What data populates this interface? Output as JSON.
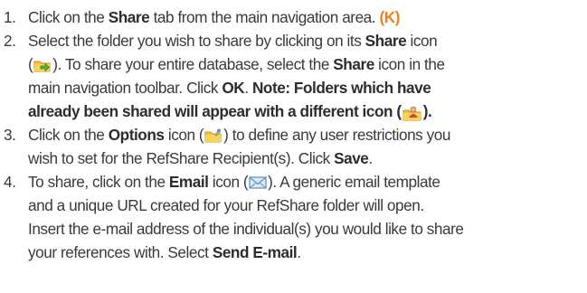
{
  "steps": [
    {
      "number": "1.",
      "t1": "Click on the ",
      "b1": "Share",
      "t2": " tab from the main navigation area.",
      "accent": "(K)"
    },
    {
      "number": "2.",
      "t1": "Select the folder you wish to share by clicking on its ",
      "b1": "Share",
      "t2": " icon",
      "t3": "(",
      "t4": ").  To share your entire database, select the ",
      "b2": "Share",
      "t5": " icon in the",
      "t6": "main navigation toolbar.  Click ",
      "b3": "OK",
      "t7": ".  ",
      "note1": "Note:  Folders which have",
      "note2": "already been shared will appear with a different icon (",
      "note3": ").",
      "icon_share": "share-folder-icon",
      "icon_shared": "shared-folder-icon"
    },
    {
      "number": "3.",
      "t1": "Click on the ",
      "b1": "Options",
      "t2": " icon (",
      "t3": ") to define any user restrictions you",
      "t4": "wish to set for the RefShare Recipient(s).  Click ",
      "b2": "Save",
      "t5": ".",
      "icon_options": "options-folder-icon"
    },
    {
      "number": "4.",
      "t1": "To share, click on the ",
      "b1": "Email",
      "t2": " icon (",
      "t3": ").  A generic email template",
      "t4": "and a unique URL created for your RefShare folder will open.",
      "t5": "Insert the e-mail address of the individual(s) you would like to share",
      "t6": "your references with.  Select ",
      "b2": "Send E-mail",
      "t7": ".",
      "icon_email": "email-envelope-icon"
    }
  ],
  "colors": {
    "text": "#3a3a3a",
    "accent": "#f07d1a"
  }
}
